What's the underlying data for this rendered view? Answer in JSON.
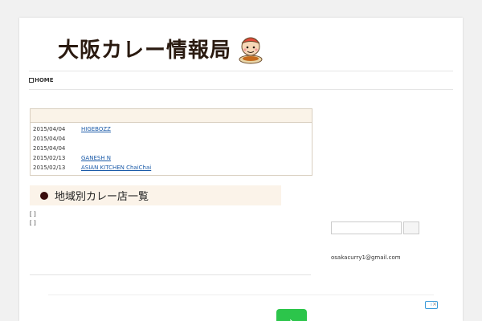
{
  "header": {
    "logo_text": "大阪カレー情報局",
    "mascot_icon": "curry-mascot-icon"
  },
  "nav": {
    "items": [
      {
        "label": "HOME",
        "icon": "home-icon"
      },
      {
        "label": ""
      },
      {
        "label": ""
      }
    ]
  },
  "news": {
    "header": "",
    "items": [
      {
        "date": "2015/04/04",
        "text": "HIGEBOZZ"
      },
      {
        "date": "2015/04/04",
        "text": ""
      },
      {
        "date": "2015/04/04",
        "text": ""
      },
      {
        "date": "2015/02/13",
        "text": "GANESH N"
      },
      {
        "date": "2015/02/13",
        "text": "ASIAN KITCHEN ChaiChai"
      }
    ]
  },
  "section": {
    "title": "地域別カレー店一覧"
  },
  "body_lines": [
    {
      "text": "[ ]",
      "color": "dark"
    },
    {
      "text": "",
      "color": "blue"
    },
    {
      "text": "",
      "color": "dark"
    },
    {
      "text": "",
      "color": "dark"
    },
    {
      "text": "[ ]",
      "color": "dark"
    },
    {
      "text": "",
      "color": "blue"
    }
  ],
  "sidebar": {
    "search_button": "",
    "contact_title": "",
    "contact_email": "osakacurry1@gmail.com"
  },
  "ad": {
    "next_icon": "chevron-right-icon",
    "choice_icon": "adchoices-icon",
    "close_icon": "close-icon"
  },
  "colors": {
    "link": "#1a5aa8",
    "accent_bg": "#fbf3e9",
    "dot": "#3a0d0d",
    "ad_button": "#2cc54b"
  }
}
